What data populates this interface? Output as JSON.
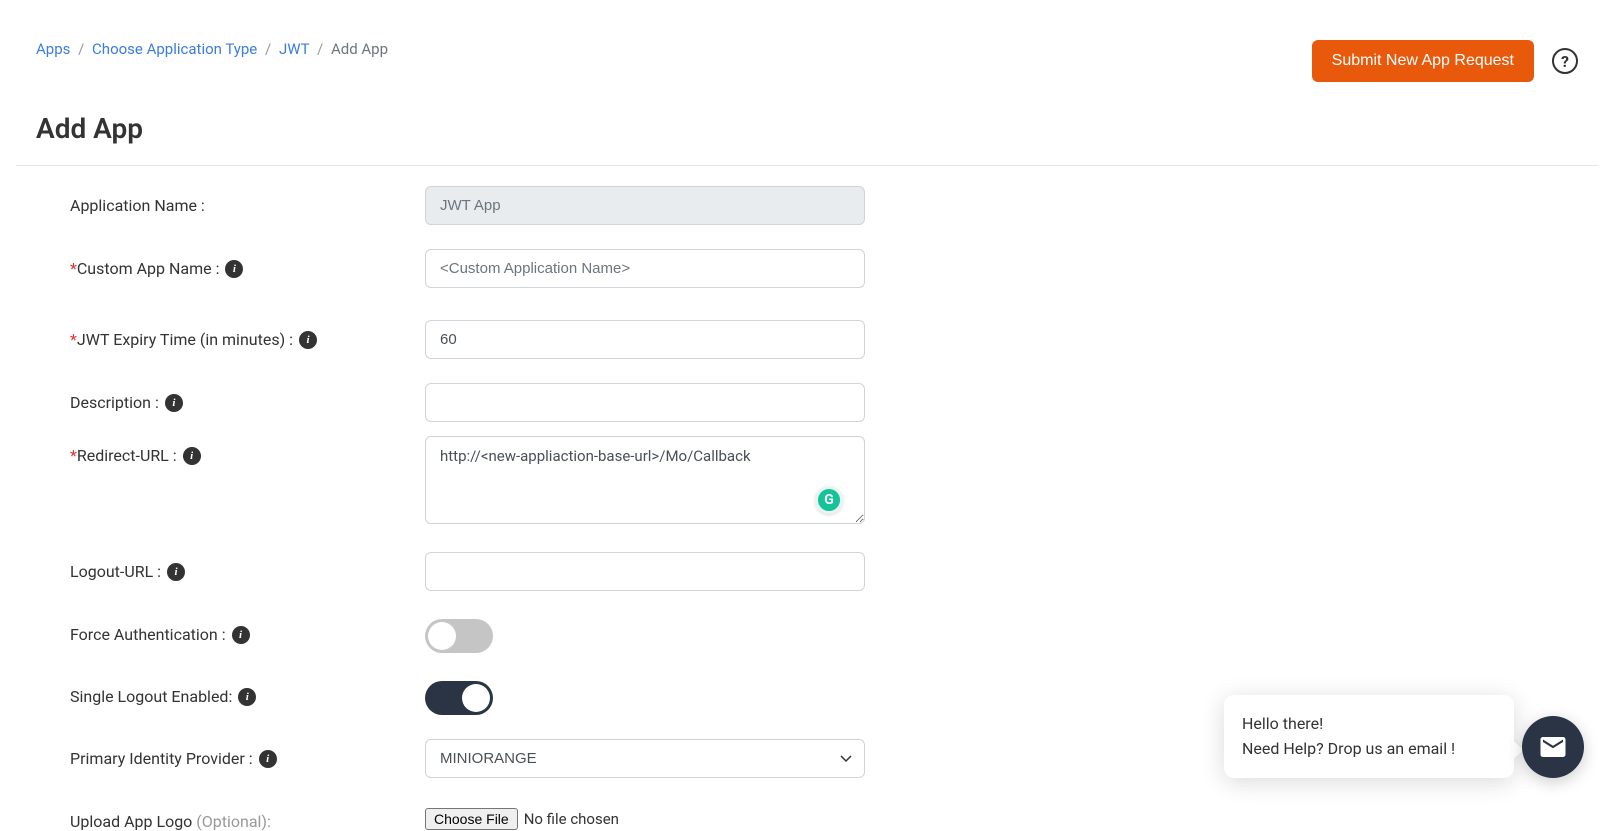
{
  "breadcrumb": {
    "items": [
      "Apps",
      "Choose Application Type",
      "JWT"
    ],
    "current": "Add App"
  },
  "actions": {
    "submit_label": "Submit New App Request"
  },
  "page_title": "Add App",
  "form": {
    "application_name": {
      "label": "Application Name :",
      "value": "JWT App"
    },
    "custom_app_name": {
      "label": "Custom App Name :",
      "placeholder": "<Custom Application Name>",
      "value": ""
    },
    "jwt_expiry": {
      "label": "JWT Expiry Time (in minutes) :",
      "value": "60"
    },
    "description": {
      "label": "Description :",
      "value": ""
    },
    "redirect_url": {
      "label": "Redirect-URL :",
      "value": "http://<new-appliaction-base-url>/Mo/Callback"
    },
    "logout_url": {
      "label": "Logout-URL :",
      "value": ""
    },
    "force_auth": {
      "label": "Force Authentication :",
      "value": false
    },
    "single_logout": {
      "label": "Single Logout Enabled:",
      "value": true
    },
    "primary_idp": {
      "label": "Primary Identity Provider :",
      "value": "MINIORANGE",
      "options": [
        "MINIORANGE"
      ]
    },
    "upload_logo": {
      "label": "Upload App Logo ",
      "optional": "(Optional):",
      "button": "Choose File",
      "status": "No file chosen"
    }
  },
  "chat": {
    "line1": "Hello there!",
    "line2": "Need Help? Drop us an email !"
  }
}
